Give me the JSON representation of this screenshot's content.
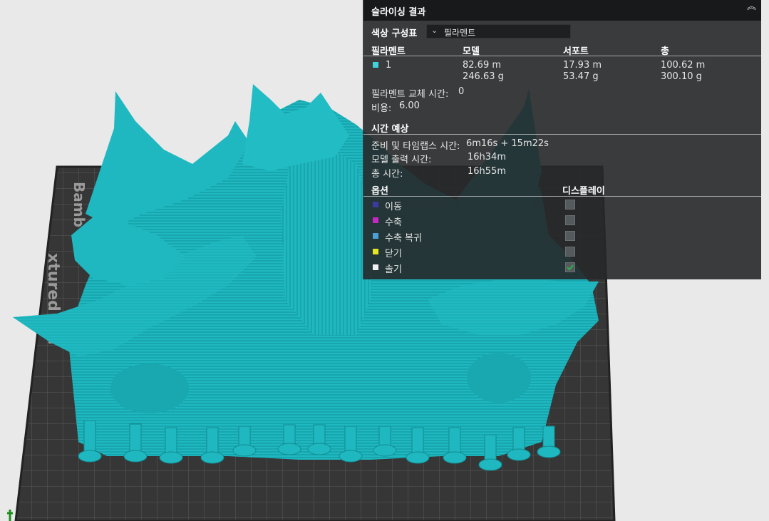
{
  "panel": {
    "title": "슬라이싱 결과",
    "collapse_icon": "double-chevron-up-icon",
    "color_scheme_label": "색상 구성표",
    "color_scheme_value": "필라멘트",
    "filament_table": {
      "headers": [
        "필라멘트",
        "모델",
        "서포트",
        "총"
      ],
      "row": {
        "id": "1",
        "color": "#3fd3dc",
        "model_length": "82.69 m",
        "model_weight": "246.63 g",
        "support_length": "17.93 m",
        "support_weight": "53.47 g",
        "total_length": "100.62 m",
        "total_weight": "300.10 g"
      }
    },
    "filament_change_label": "필라멘트 교체 시간:",
    "filament_change_value": "0",
    "cost_label": "비용:",
    "cost_value": "6.00",
    "time_header": "시간 예상",
    "prep_label": "준비 및 타임랩스 시간:",
    "prep_value": "6m16s + 15m22s",
    "model_time_label": "모델 출력 시간:",
    "model_time_value": "16h34m",
    "total_time_label": "총 시간:",
    "total_time_value": "16h55m",
    "options_header": "옵션",
    "display_header": "디스플레이",
    "options": [
      {
        "label": "이동",
        "color": "#3a3aa0",
        "checked": false
      },
      {
        "label": "수축",
        "color": "#c528c5",
        "checked": false
      },
      {
        "label": "수축 복귀",
        "color": "#4aa0d8",
        "checked": false
      },
      {
        "label": "닫기",
        "color": "#e6e620",
        "checked": false
      },
      {
        "label": "솔기",
        "color": "#f0f0f0",
        "checked": true
      }
    ]
  },
  "bed": {
    "label_top": "Bamb",
    "label_bottom": "xtured PEI"
  },
  "colors": {
    "model": "#1fb8c0",
    "bed": "#3a3a3a",
    "panel_bg": "#26282a"
  }
}
